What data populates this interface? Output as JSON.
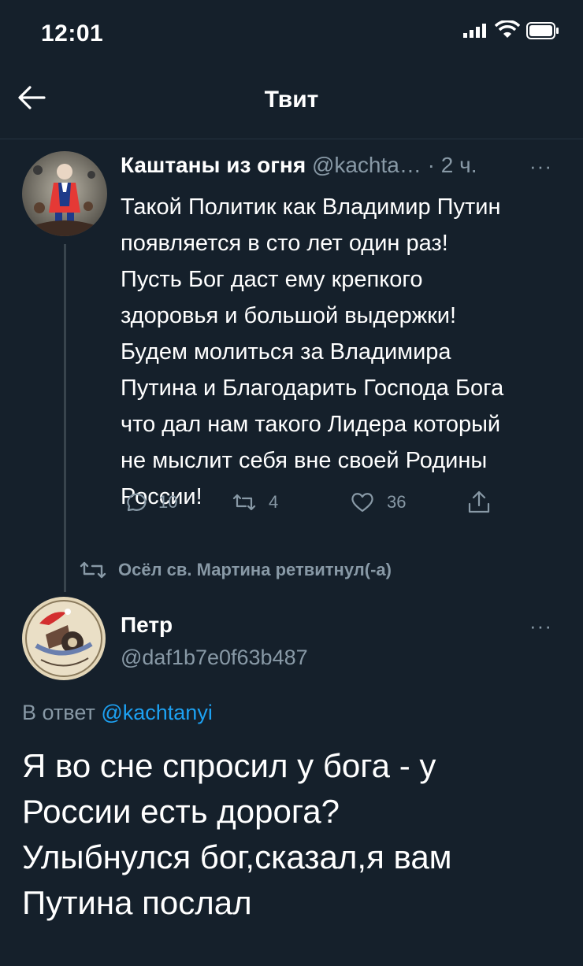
{
  "status_bar": {
    "time": "12:01",
    "signal_icon": "cellular-signal-icon",
    "wifi_icon": "wifi-icon",
    "battery_icon": "battery-icon"
  },
  "header": {
    "back_icon": "arrow-left-icon",
    "title": "Твит"
  },
  "parent_tweet": {
    "author_name": "Каштаны из огня",
    "handle": "@kachta…",
    "separator": "·",
    "time": "2 ч.",
    "more_label": "···",
    "text_lines": [
      "Такой Политик как Владимир Путин",
      "появляется в сто лет один раз!",
      "Пусть Бог даст ему крепкого",
      "здоровья и большой выдержки!",
      "Будем молиться за Владимира",
      "Путина и Благодарить Господа Бога",
      "что дал нам такого Лидера который",
      "не мыслит себя вне своей Родины",
      "России!"
    ],
    "actions": {
      "reply_count": "10",
      "retweet_count": "4",
      "like_count": "36"
    },
    "retweet_note": "Осёл св. Мартина ретвитнул(-а)"
  },
  "reply_tweet": {
    "author_name": "Петр",
    "handle": "@daf1b7e0f63b487",
    "more_label": "···",
    "reply_to_prefix": "В ответ",
    "reply_to_handle": "@kachtanyi",
    "text_lines": [
      "Я во сне спросил у бога - у",
      "России есть дорога?",
      "Улыбнулся бог,сказал,я вам",
      "Путина послал"
    ]
  },
  "colors": {
    "background": "#15202b",
    "secondary_text": "#8899a6",
    "link": "#1da1f2",
    "divider": "#38444d"
  }
}
